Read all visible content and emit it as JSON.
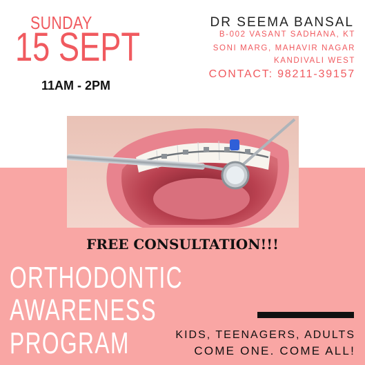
{
  "event": {
    "day": "SUNDAY",
    "date": "15 SEPT",
    "time": "11AM - 2PM"
  },
  "doctor": {
    "name": "DR SEEMA BANSAL",
    "address_line1": "B-002 VASANT SADHANA, KT",
    "address_line2": "SONI MARG,  MAHAVIR NAGAR",
    "address_line3": "KANDIVALI WEST",
    "contact": "CONTACT: 98211-39157"
  },
  "offer": "FREE CONSULTATION!!!",
  "program": {
    "line1": "ORTHODONTIC",
    "line2": "AWARENESS",
    "line3": "PROGRAM"
  },
  "audience": {
    "line1": "KIDS, TEENAGERS, ADULTS",
    "line2": "COME ONE. COME ALL!"
  },
  "colors": {
    "accent": "#f05a5f",
    "pink_band": "#f9a6a4",
    "text_dark": "#111111"
  }
}
